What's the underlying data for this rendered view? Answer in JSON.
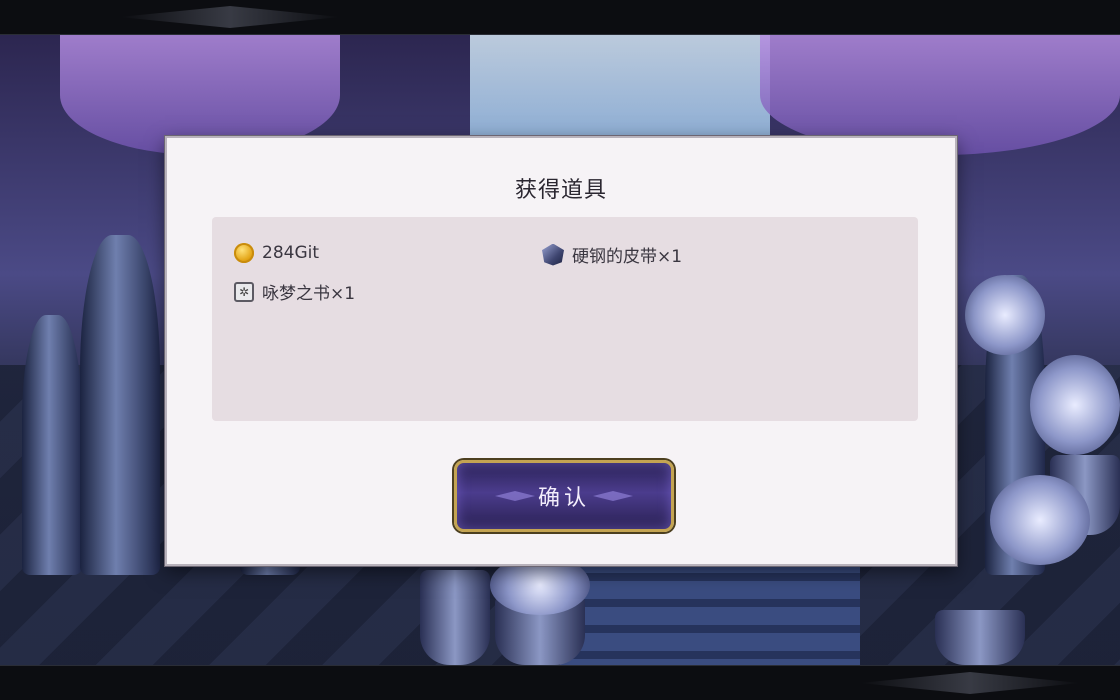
{
  "dialog": {
    "title": "获得道具",
    "items": [
      {
        "label": "284Git",
        "icon": "gold-coin-icon"
      },
      {
        "label": "硬钢的皮带×1",
        "icon": "steel-belt-icon"
      },
      {
        "label": "咏梦之书×1",
        "icon": "dream-book-icon"
      }
    ],
    "confirm_label": "确认"
  },
  "colors": {
    "dialog_bg": "#f6f3f6",
    "panel_bg": "#e6dde2",
    "button_bg": "#4b3c8d",
    "button_border": "#c4a452"
  }
}
